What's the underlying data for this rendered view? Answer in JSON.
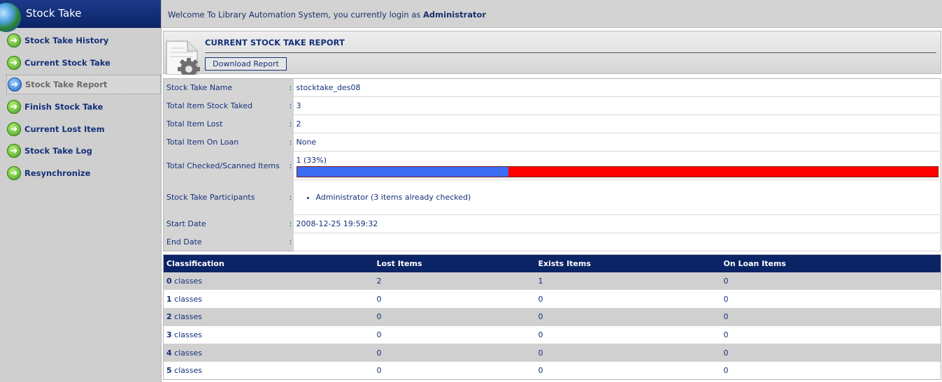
{
  "sidebar": {
    "title": "Stock Take",
    "items": [
      {
        "label": "Stock Take History",
        "active": false
      },
      {
        "label": "Current Stock Take",
        "active": false
      },
      {
        "label": "Stock Take Report",
        "active": true
      },
      {
        "label": "Finish Stock Take",
        "active": false
      },
      {
        "label": "Current Lost Item",
        "active": false
      },
      {
        "label": "Stock Take Log",
        "active": false
      },
      {
        "label": "Resynchronize",
        "active": false
      }
    ]
  },
  "topbar": {
    "welcome_text": "Welcome To Library Automation System, you currently login as ",
    "username": "Administrator"
  },
  "report": {
    "title": "CURRENT STOCK TAKE REPORT",
    "download_label": "Download Report"
  },
  "info": {
    "separator": ":",
    "name_label": "Stock Take Name",
    "name_value": "stocktake_des08",
    "total_taked_label": "Total Item Stock Taked",
    "total_taked_value": "3",
    "total_lost_label": "Total Item Lost",
    "total_lost_value": "2",
    "on_loan_label": "Total Item On Loan",
    "on_loan_value": "None",
    "checked_label": "Total Checked/Scanned Items",
    "checked_value": "1 (33%)",
    "checked_fraction": 0.33,
    "participants_label": "Stock Take Participants",
    "participants": [
      "Administrator (3 items already checked)"
    ],
    "start_label": "Start Date",
    "start_value": "2008-12-25 19:59:32",
    "end_label": "End Date",
    "end_value": ""
  },
  "classes": {
    "headers": [
      "Classification",
      "Lost Items",
      "Exists Items",
      "On Loan Items"
    ],
    "suffix": "classes",
    "rows": [
      {
        "num": "0",
        "lost": "2",
        "exists": "1",
        "loan": "0"
      },
      {
        "num": "1",
        "lost": "0",
        "exists": "0",
        "loan": "0"
      },
      {
        "num": "2",
        "lost": "0",
        "exists": "0",
        "loan": "0"
      },
      {
        "num": "3",
        "lost": "0",
        "exists": "0",
        "loan": "0"
      },
      {
        "num": "4",
        "lost": "0",
        "exists": "0",
        "loan": "0"
      },
      {
        "num": "5",
        "lost": "0",
        "exists": "0",
        "loan": "0"
      }
    ]
  },
  "colors": {
    "navy": "#0b2466",
    "progress_done": "#3a6cf4",
    "progress_remaining": "#ff0000"
  }
}
